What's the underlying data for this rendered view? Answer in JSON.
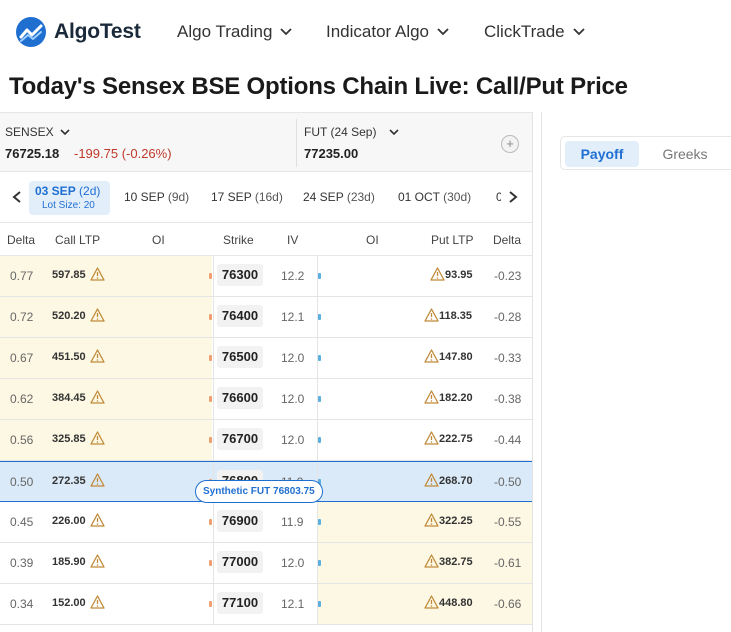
{
  "nav": {
    "logo": "AlgoTest",
    "items": [
      "Algo Trading",
      "Indicator Algo",
      "ClickTrade"
    ]
  },
  "title": "Today's Sensex BSE Options Chain Live: Call/Put Price",
  "symbols": {
    "left": {
      "name": "SENSEX",
      "price": "76725.18",
      "change": "-199.75 (-0.26%)"
    },
    "right": {
      "name": "FUT (24 Sep)",
      "price": "77235.00"
    },
    "add": "+"
  },
  "expiries": {
    "active": {
      "date": "03 SEP",
      "days": "(2d)",
      "lot": "Lot Size: 20"
    },
    "others": [
      {
        "date": "10 SEP",
        "days": "(9d)"
      },
      {
        "date": "17 SEP",
        "days": "(16d)"
      },
      {
        "date": "24 SEP",
        "days": "(23d)"
      },
      {
        "date": "01 OCT",
        "days": "(30d)"
      },
      {
        "date": "0",
        "days": ""
      }
    ]
  },
  "columns": [
    "Delta",
    "Call LTP",
    "OI",
    "Strike",
    "IV",
    "OI",
    "Put LTP",
    "Delta"
  ],
  "rows": [
    {
      "cdelta": "0.77",
      "cltp": "597.85",
      "strike": "76300",
      "iv": "12.2",
      "pltp": "93.95",
      "pdelta": "-0.23"
    },
    {
      "cdelta": "0.72",
      "cltp": "520.20",
      "strike": "76400",
      "iv": "12.1",
      "pltp": "118.35",
      "pdelta": "-0.28"
    },
    {
      "cdelta": "0.67",
      "cltp": "451.50",
      "strike": "76500",
      "iv": "12.0",
      "pltp": "147.80",
      "pdelta": "-0.33"
    },
    {
      "cdelta": "0.62",
      "cltp": "384.45",
      "strike": "76600",
      "iv": "12.0",
      "pltp": "182.20",
      "pdelta": "-0.38"
    },
    {
      "cdelta": "0.56",
      "cltp": "325.85",
      "strike": "76700",
      "iv": "12.0",
      "pltp": "222.75",
      "pdelta": "-0.44"
    },
    {
      "cdelta": "0.50",
      "cltp": "272.35",
      "strike": "76800",
      "iv": "11.9",
      "pltp": "268.70",
      "pdelta": "-0.50"
    },
    {
      "cdelta": "0.45",
      "cltp": "226.00",
      "strike": "76900",
      "iv": "11.9",
      "pltp": "322.25",
      "pdelta": "-0.55"
    },
    {
      "cdelta": "0.39",
      "cltp": "185.90",
      "strike": "77000",
      "iv": "12.0",
      "pltp": "382.75",
      "pdelta": "-0.61"
    },
    {
      "cdelta": "0.34",
      "cltp": "152.00",
      "strike": "77100",
      "iv": "12.1",
      "pltp": "448.80",
      "pdelta": "-0.66"
    }
  ],
  "synthetic": "Synthetic FUT 76803.75",
  "tabs": {
    "payoff": "Payoff",
    "greeks": "Greeks"
  },
  "colors": {
    "accent": "#1f6fd1",
    "negative": "#c0392b",
    "itm": "#fdf8e4",
    "atm": "#dbeaf8"
  }
}
